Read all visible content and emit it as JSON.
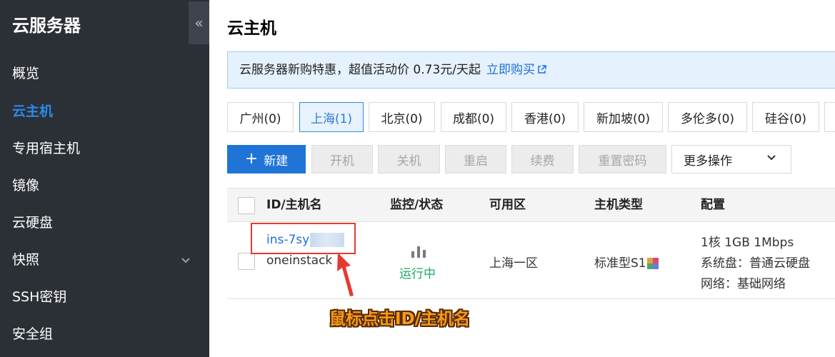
{
  "sidebar": {
    "title": "云服务器",
    "collapse_glyph": "«",
    "items": [
      {
        "label": "概览"
      },
      {
        "label": "云主机"
      },
      {
        "label": "专用宿主机"
      },
      {
        "label": "镜像"
      },
      {
        "label": "云硬盘"
      },
      {
        "label": "快照"
      },
      {
        "label": "SSH密钥"
      },
      {
        "label": "安全组"
      }
    ],
    "active_item": "云主机"
  },
  "main": {
    "title": "云主机",
    "notice": {
      "text": "云服务器新购特惠，超值活动价 0.73元/天起",
      "link": "立即购买",
      "link_icon": "external-link-icon"
    },
    "regions": [
      "广州(0)",
      "上海(1)",
      "北京(0)",
      "成都(0)",
      "香港(0)",
      "新加坡(0)",
      "多伦多(0)",
      "硅谷(0)"
    ],
    "active_region": "上海(1)",
    "toolbar": {
      "new": "新建",
      "new_icon": "plus-icon",
      "start": "开机",
      "stop": "关机",
      "restart": "重启",
      "renew": "续费",
      "reset_password": "重置密码",
      "more": "更多操作",
      "more_icon": "chevron-down-icon"
    },
    "table": {
      "headers": [
        "ID/主机名",
        "监控/状态",
        "可用区",
        "主机类型",
        "配置"
      ],
      "rows": [
        {
          "id": "ins-7sy",
          "hostname": "oneinstack",
          "status": "运行中",
          "zone": "上海一区",
          "type": "标准型S1",
          "config_1": "1核 1GB 1Mbps",
          "config_2": "系统盘：普通云硬盘",
          "config_3": "网络：基础网络"
        }
      ]
    }
  },
  "annotation": {
    "text": "鼠标点击ID/主机名",
    "color": "#f59a1b",
    "highlight_color": "#e53a2f"
  }
}
